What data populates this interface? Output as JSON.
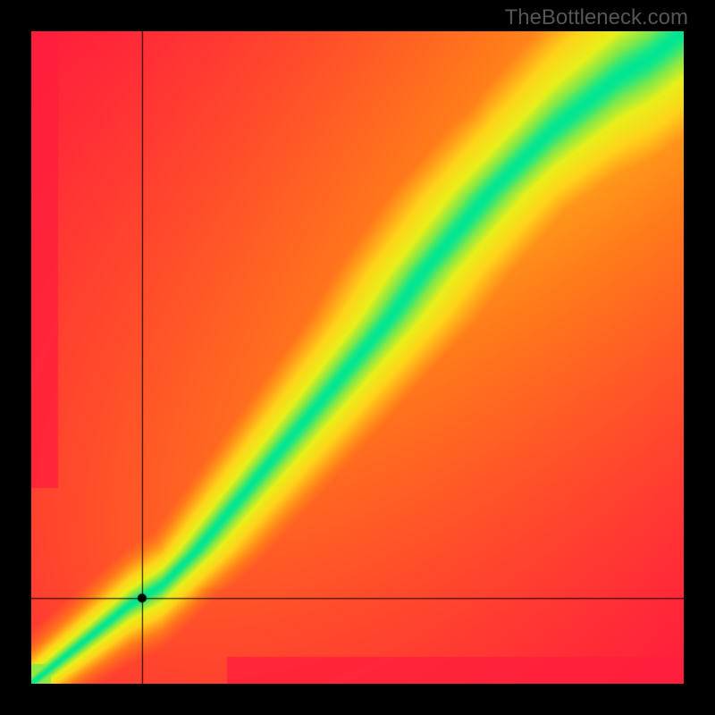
{
  "watermark": "TheBottleneck.com",
  "chart_data": {
    "type": "heatmap",
    "title": "",
    "xlabel": "",
    "ylabel": "",
    "xlim": [
      0,
      100
    ],
    "ylim": [
      0,
      100
    ],
    "marker": {
      "x": 17,
      "y": 13
    },
    "crosshair": {
      "x": 17,
      "y": 13
    },
    "optimal_curve": {
      "description": "Green optimal-balance band; x is one component score, y is the matching component score. Curve is slightly superlinear above ~20.",
      "points": [
        {
          "x": 0,
          "y": 0
        },
        {
          "x": 5,
          "y": 4
        },
        {
          "x": 10,
          "y": 8
        },
        {
          "x": 15,
          "y": 12
        },
        {
          "x": 20,
          "y": 15
        },
        {
          "x": 25,
          "y": 20
        },
        {
          "x": 30,
          "y": 26
        },
        {
          "x": 35,
          "y": 32
        },
        {
          "x": 40,
          "y": 38
        },
        {
          "x": 45,
          "y": 44
        },
        {
          "x": 50,
          "y": 50
        },
        {
          "x": 55,
          "y": 56
        },
        {
          "x": 60,
          "y": 63
        },
        {
          "x": 65,
          "y": 69
        },
        {
          "x": 70,
          "y": 75
        },
        {
          "x": 75,
          "y": 80
        },
        {
          "x": 80,
          "y": 85
        },
        {
          "x": 85,
          "y": 89
        },
        {
          "x": 90,
          "y": 93
        },
        {
          "x": 95,
          "y": 96
        },
        {
          "x": 100,
          "y": 100
        }
      ],
      "band_halfwidth_start": 2,
      "band_halfwidth_end": 9
    },
    "color_scale": {
      "stops": [
        {
          "t": 0.0,
          "color": "#ff1e3c"
        },
        {
          "t": 0.35,
          "color": "#ff7a1a"
        },
        {
          "t": 0.6,
          "color": "#ffd21a"
        },
        {
          "t": 0.8,
          "color": "#e8f01a"
        },
        {
          "t": 0.92,
          "color": "#7fe84a"
        },
        {
          "t": 1.0,
          "color": "#00e693"
        }
      ]
    }
  }
}
